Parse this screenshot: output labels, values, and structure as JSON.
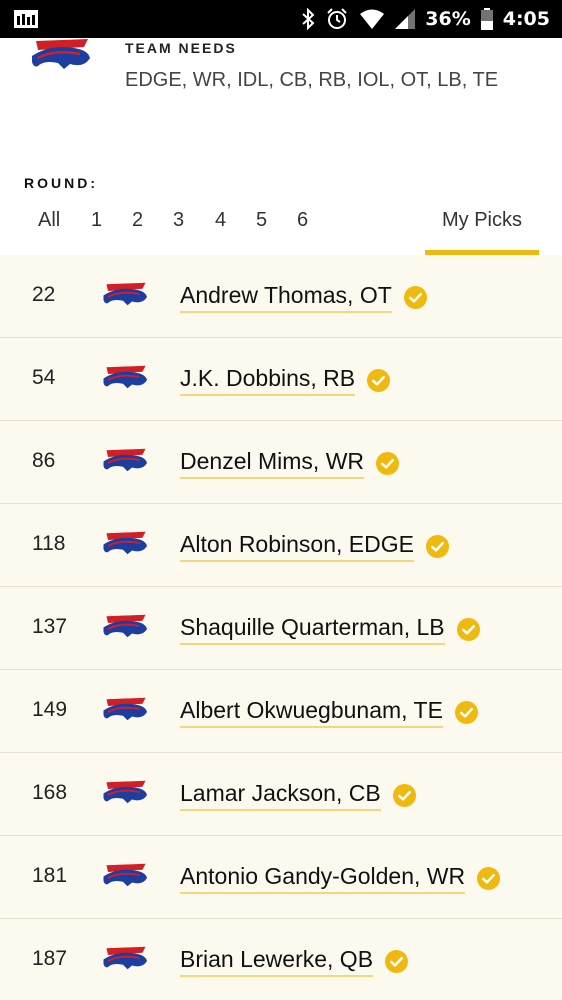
{
  "status_bar": {
    "battery": "36%",
    "time": "4:05",
    "icons": [
      "app-icon",
      "bluetooth-icon",
      "alarm-icon",
      "wifi-icon",
      "signal-icon",
      "battery-icon"
    ]
  },
  "team_needs": {
    "title": "TEAM NEEDS",
    "list": "EDGE, WR, IDL, CB, RB, IOL, OT, LB, TE"
  },
  "round": {
    "label": "ROUND:",
    "tabs": [
      "All",
      "1",
      "2",
      "3",
      "4",
      "5",
      "6"
    ],
    "my_picks": "My Picks",
    "selected": "My Picks"
  },
  "picks": [
    {
      "number": "22",
      "name": "Andrew Thomas, OT"
    },
    {
      "number": "54",
      "name": "J.K. Dobbins, RB"
    },
    {
      "number": "86",
      "name": "Denzel Mims, WR"
    },
    {
      "number": "118",
      "name": "Alton Robinson, EDGE"
    },
    {
      "number": "137",
      "name": "Shaquille Quarterman, LB"
    },
    {
      "number": "149",
      "name": "Albert Okwuegbunam, TE"
    },
    {
      "number": "168",
      "name": "Lamar Jackson, CB"
    },
    {
      "number": "181",
      "name": "Antonio Gandy-Golden, WR"
    },
    {
      "number": "187",
      "name": "Brian Lewerke, QB"
    }
  ],
  "colors": {
    "accent": "#f0b90f",
    "team_blue": "#1d3ea1",
    "team_red": "#d21f26",
    "row_bg": "#fcf9ee"
  }
}
